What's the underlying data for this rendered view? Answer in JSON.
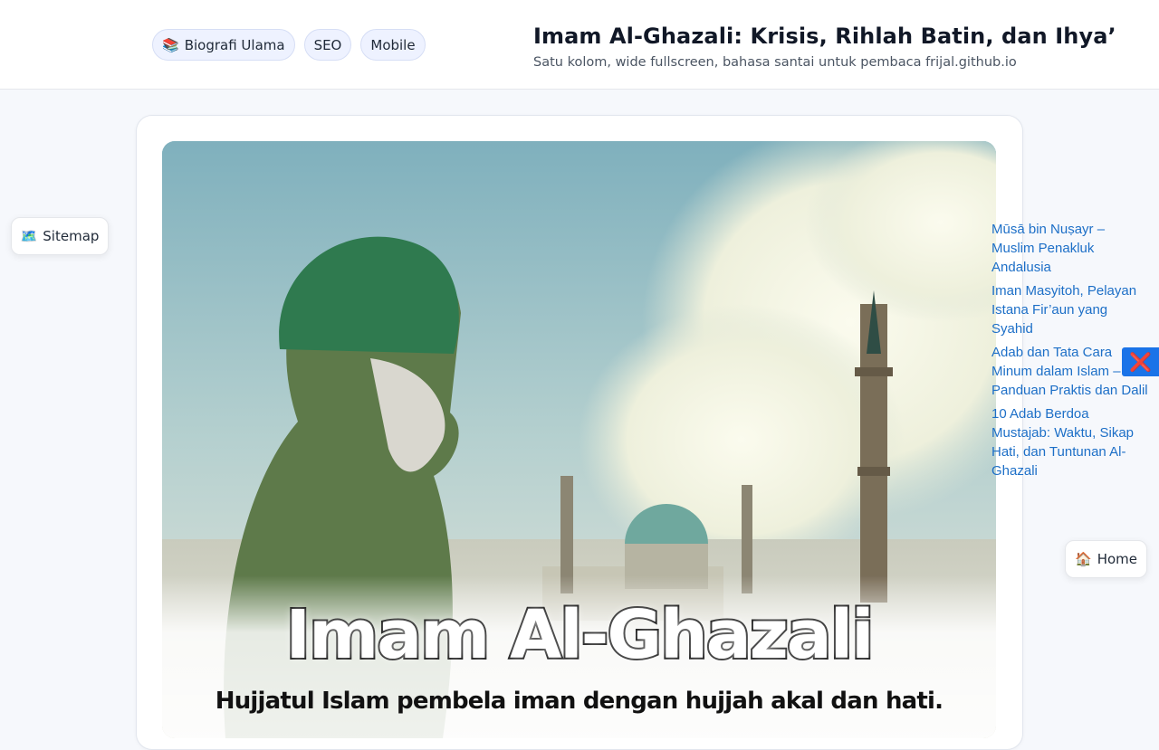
{
  "header": {
    "tags": [
      {
        "emoji": "📚",
        "label": "Biografi Ulama"
      },
      {
        "label": "SEO"
      },
      {
        "label": "Mobile"
      }
    ],
    "title": "Imam Al-Ghazali: Krisis, Rihlah Batin, dan Ihya’",
    "subtitle": "Satu kolom, wide fullscreen, bahasa santai untuk pembaca frijal.github.io"
  },
  "hero": {
    "title": "Imam Al-Ghazali",
    "subtitle": "Hujjatul Islam pembela iman dengan hujjah akal dan hati."
  },
  "sitemap": {
    "emoji": "🗺️",
    "label": "Sitemap"
  },
  "home": {
    "emoji": "🏠",
    "label": "Home"
  },
  "related_links": [
    "Mūsā bin Nuṣayr – Muslim Penakluk Andalusia",
    "Iman Masyitoh, Pelayan Istana Fir’aun yang Syahid",
    "Adab dan Tata Cara Minum dalam Islam – Panduan Praktis dan Dalil",
    "10 Adab Berdoa Mustajab: Waktu, Sikap Hati, dan Tuntunan Al-Ghazali"
  ],
  "close_button": {
    "symbol": "❌"
  },
  "colors": {
    "link": "#1d6fc7",
    "tag_bg": "#eef2ff",
    "close_bg": "#1a73e8"
  }
}
